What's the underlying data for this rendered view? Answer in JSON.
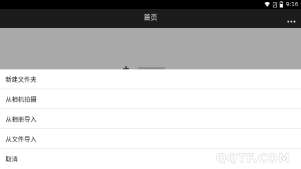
{
  "status_bar": {
    "time": "9:16",
    "icons": [
      "wifi-icon",
      "no-sim-icon",
      "battery-icon"
    ]
  },
  "app_bar": {
    "title": "首页",
    "more_icon": "more-dots-icon"
  },
  "background": {
    "add_icon": "plus-icon"
  },
  "action_sheet": {
    "items": [
      {
        "label": "新建文件夹"
      },
      {
        "label": "从相机拍摄"
      },
      {
        "label": "从相册导入"
      },
      {
        "label": "从文件导入"
      },
      {
        "label": "取消"
      }
    ]
  },
  "watermark": {
    "text": "QQTF.COM"
  }
}
